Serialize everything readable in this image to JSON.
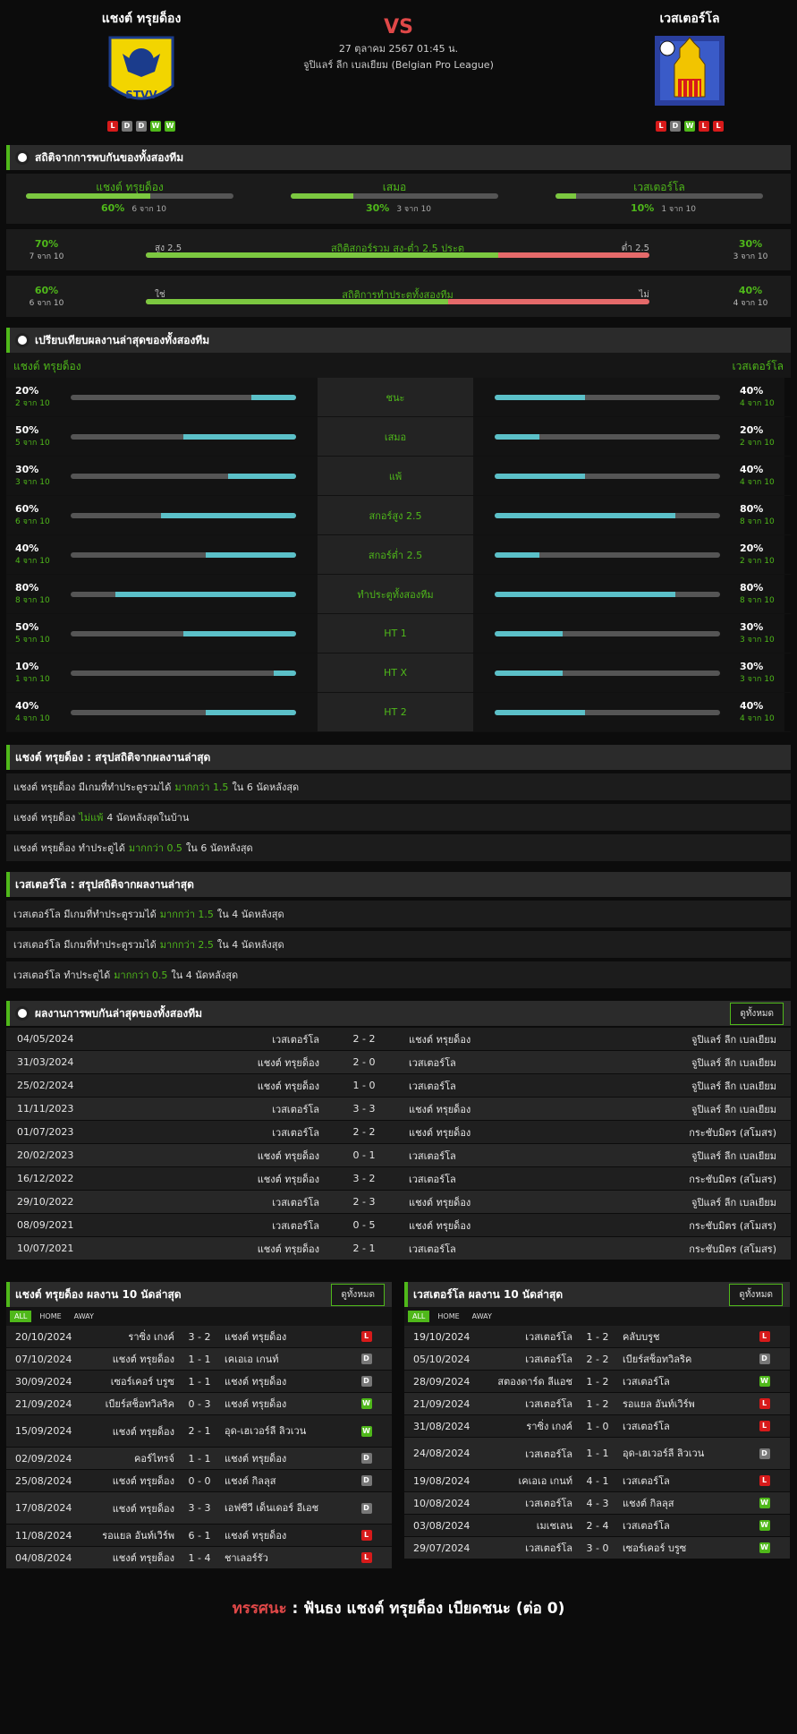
{
  "header": {
    "home_name": "แชงต์ ทรุยด็อง",
    "away_name": "เวสเตอร์โล",
    "vs": "VS",
    "datetime": "27 ตุลาคม 2567 01:45 น.",
    "league": "จูปิแลร์ ลีก เบลเยียม (Belgian Pro League)",
    "home_form": [
      "L",
      "D",
      "D",
      "W",
      "W"
    ],
    "away_form": [
      "L",
      "D",
      "W",
      "L",
      "L"
    ],
    "home_logo_text": "STVV"
  },
  "h2h": {
    "title": "สถิติจากการพบกันของทั้งสองทีม",
    "cols": [
      {
        "label": "แชงต์ ทรุยด็อง",
        "pct": "60%",
        "sub": "6 จาก 10",
        "fill": 0.6
      },
      {
        "label": "เสมอ",
        "pct": "30%",
        "sub": "3 จาก 10",
        "fill": 0.3
      },
      {
        "label": "เวสเตอร์โล",
        "pct": "10%",
        "sub": "1 จาก 10",
        "fill": 0.1
      }
    ],
    "goals": {
      "left_pct": "70%",
      "left_sub": "7 จาก 10",
      "title": "สถิติสกอร์รวม สูง-ต่ำ 2.5 ประตู",
      "ll": "สูง 2.5",
      "rl": "ต่ำ 2.5",
      "right_pct": "30%",
      "right_sub": "3 จาก 10",
      "fill": 0.7
    },
    "btts": {
      "left_pct": "60%",
      "left_sub": "6 จาก 10",
      "title": "สถิติการทำประตูทั้งสองทีม",
      "ll": "ใช่",
      "rl": "ไม่",
      "right_pct": "40%",
      "right_sub": "4 จาก 10",
      "fill": 0.6
    }
  },
  "compare": {
    "title": "เปรียบเทียบผลงานล่าสุดของทั้งสองทีม",
    "home": "แชงต์ ทรุยด็อง",
    "away": "เวสเตอร์โล",
    "rows": [
      {
        "label": "ชนะ",
        "hp": "20%",
        "hs": "2 จาก 10",
        "hv": 0.2,
        "ap": "40%",
        "as": "4 จาก 10",
        "av": 0.4
      },
      {
        "label": "เสมอ",
        "hp": "50%",
        "hs": "5 จาก 10",
        "hv": 0.5,
        "ap": "20%",
        "as": "2 จาก 10",
        "av": 0.2
      },
      {
        "label": "แพ้",
        "hp": "30%",
        "hs": "3 จาก 10",
        "hv": 0.3,
        "ap": "40%",
        "as": "4 จาก 10",
        "av": 0.4
      },
      {
        "label": "สกอร์สูง 2.5",
        "hp": "60%",
        "hs": "6 จาก 10",
        "hv": 0.6,
        "ap": "80%",
        "as": "8 จาก 10",
        "av": 0.8
      },
      {
        "label": "สกอร์ต่ำ 2.5",
        "hp": "40%",
        "hs": "4 จาก 10",
        "hv": 0.4,
        "ap": "20%",
        "as": "2 จาก 10",
        "av": 0.2
      },
      {
        "label": "ทำประตูทั้งสองทีม",
        "hp": "80%",
        "hs": "8 จาก 10",
        "hv": 0.8,
        "ap": "80%",
        "as": "8 จาก 10",
        "av": 0.8
      },
      {
        "label": "HT 1",
        "hp": "50%",
        "hs": "5 จาก 10",
        "hv": 0.5,
        "ap": "30%",
        "as": "3 จาก 10",
        "av": 0.3
      },
      {
        "label": "HT X",
        "hp": "10%",
        "hs": "1 จาก 10",
        "hv": 0.1,
        "ap": "30%",
        "as": "3 จาก 10",
        "av": 0.3
      },
      {
        "label": "HT 2",
        "hp": "40%",
        "hs": "4 จาก 10",
        "hv": 0.4,
        "ap": "40%",
        "as": "4 จาก 10",
        "av": 0.4
      }
    ]
  },
  "summary_home": {
    "title": "แชงต์ ทรุยด็อง : สรุปสถิติจากผลงานล่าสุด",
    "rows": [
      {
        "a": "แชงต์ ทรุยด็อง  มีเกมที่ทำประตูรวมได้",
        "h": "มากกว่า  1.5",
        "b": "ใน 6 นัดหลังสุด"
      },
      {
        "a": "แชงต์ ทรุยด็อง",
        "h": "ไม่แพ้",
        "b": "4  นัดหลังสุดในบ้าน"
      },
      {
        "a": "แชงต์ ทรุยด็อง  ทำประตูได้",
        "h": "มากกว่า  0.5",
        "b": "ใน 6 นัดหลังสุด"
      }
    ]
  },
  "summary_away": {
    "title": "เวสเตอร์โล : สรุปสถิติจากผลงานล่าสุด",
    "rows": [
      {
        "a": "เวสเตอร์โล  มีเกมที่ทำประตูรวมได้",
        "h": "มากกว่า  1.5",
        "b": "ใน 4 นัดหลังสุด"
      },
      {
        "a": "เวสเตอร์โล  มีเกมที่ทำประตูรวมได้",
        "h": "มากกว่า  2.5",
        "b": "ใน 4 นัดหลังสุด"
      },
      {
        "a": "เวสเตอร์โล  ทำประตูได้",
        "h": "มากกว่า  0.5",
        "b": "ใน 4 นัดหลังสุด"
      }
    ]
  },
  "matches": {
    "title": "ผลงานการพบกันล่าสุดของทั้งสองทีม",
    "btn": "ดูทั้งหมด",
    "rows": [
      [
        "04/05/2024",
        "เวสเตอร์โล",
        "2 - 2",
        "แชงต์ ทรุยด็อง",
        "จูปิแลร์ ลีก เบลเยียม"
      ],
      [
        "31/03/2024",
        "แชงต์ ทรุยด็อง",
        "2 - 0",
        "เวสเตอร์โล",
        "จูปิแลร์ ลีก เบลเยียม"
      ],
      [
        "25/02/2024",
        "แชงต์ ทรุยด็อง",
        "1 - 0",
        "เวสเตอร์โล",
        "จูปิแลร์ ลีก เบลเยียม"
      ],
      [
        "11/11/2023",
        "เวสเตอร์โล",
        "3 - 3",
        "แชงต์ ทรุยด็อง",
        "จูปิแลร์ ลีก เบลเยียม"
      ],
      [
        "01/07/2023",
        "เวสเตอร์โล",
        "2 - 2",
        "แชงต์ ทรุยด็อง",
        "กระชับมิตร (สโมสร)"
      ],
      [
        "20/02/2023",
        "แชงต์ ทรุยด็อง",
        "0 - 1",
        "เวสเตอร์โล",
        "จูปิแลร์ ลีก เบลเยียม"
      ],
      [
        "16/12/2022",
        "แชงต์ ทรุยด็อง",
        "3 - 2",
        "เวสเตอร์โล",
        "กระชับมิตร (สโมสร)"
      ],
      [
        "29/10/2022",
        "เวสเตอร์โล",
        "2 - 3",
        "แชงต์ ทรุยด็อง",
        "จูปิแลร์ ลีก เบลเยียม"
      ],
      [
        "08/09/2021",
        "เวสเตอร์โล",
        "0 - 5",
        "แชงต์ ทรุยด็อง",
        "กระชับมิตร (สโมสร)"
      ],
      [
        "10/07/2021",
        "แชงต์ ทรุยด็อง",
        "2 - 1",
        "เวสเตอร์โล",
        "กระชับมิตร (สโมสร)"
      ]
    ]
  },
  "last_home": {
    "title": "แชงต์ ทรุยด็อง ผลงาน 10 นัดล่าสุด",
    "btn": "ดูทั้งหมด",
    "tabs": [
      "ALL",
      "HOME",
      "AWAY"
    ],
    "rows": [
      [
        "20/10/2024",
        "ราซิ่ง เกงค์",
        "3 - 2",
        "แชงต์ ทรุยด็อง",
        "L"
      ],
      [
        "07/10/2024",
        "แชงต์ ทรุยด็อง",
        "1 - 1",
        "เคเอเอ เกนท์",
        "D"
      ],
      [
        "30/09/2024",
        "เซอร์เคอร์ บรูซ",
        "1 - 1",
        "แชงต์ ทรุยด็อง",
        "D"
      ],
      [
        "21/09/2024",
        "เบียร์สช็อทวิลริค",
        "0 - 3",
        "แชงต์ ทรุยด็อง",
        "W"
      ],
      [
        "15/09/2024",
        "แชงต์ ทรุยด็อง",
        "2 - 1",
        "อุด-เฮเวอร์ลี ลิวเวน",
        "W"
      ],
      [
        "02/09/2024",
        "คอร์ไทรจ์",
        "1 - 1",
        "แชงต์ ทรุยด็อง",
        "D"
      ],
      [
        "25/08/2024",
        "แชงต์ ทรุยด็อง",
        "0 - 0",
        "แชงต์ กิลลุส",
        "D"
      ],
      [
        "17/08/2024",
        "แชงต์ ทรุยด็อง",
        "3 - 3",
        "เอฟซีวี เด็นเดอร์ อีเอช",
        "D"
      ],
      [
        "11/08/2024",
        "รอแยล อันท์เวิร์พ",
        "6 - 1",
        "แชงต์ ทรุยด็อง",
        "L"
      ],
      [
        "04/08/2024",
        "แชงต์ ทรุยด็อง",
        "1 - 4",
        "ชาเลอร์รัว",
        "L"
      ]
    ]
  },
  "last_away": {
    "title": "เวสเตอร์โล ผลงาน 10 นัดล่าสุด",
    "btn": "ดูทั้งหมด",
    "tabs": [
      "ALL",
      "HOME",
      "AWAY"
    ],
    "rows": [
      [
        "19/10/2024",
        "เวสเตอร์โล",
        "1 - 2",
        "คลับบรูช",
        "L"
      ],
      [
        "05/10/2024",
        "เวสเตอร์โล",
        "2 - 2",
        "เบียร์สช็อทวิลริค",
        "D"
      ],
      [
        "28/09/2024",
        "สตองดาร์ด ลีแอช",
        "1 - 2",
        "เวสเตอร์โล",
        "W"
      ],
      [
        "21/09/2024",
        "เวสเตอร์โล",
        "1 - 2",
        "รอแยล อันท์เวิร์พ",
        "L"
      ],
      [
        "31/08/2024",
        "ราซิ่ง เกงค์",
        "1 - 0",
        "เวสเตอร์โล",
        "L"
      ],
      [
        "24/08/2024",
        "เวสเตอร์โล",
        "1 - 1",
        "อุด-เฮเวอร์ลี ลิวเวน",
        "D"
      ],
      [
        "19/08/2024",
        "เคเอเอ เกนท์",
        "4 - 1",
        "เวสเตอร์โล",
        "L"
      ],
      [
        "10/08/2024",
        "เวสเตอร์โล",
        "4 - 3",
        "แชงต์ กิลลุส",
        "W"
      ],
      [
        "03/08/2024",
        "เมเชเลน",
        "2 - 4",
        "เวสเตอร์โล",
        "W"
      ],
      [
        "29/07/2024",
        "เวสเตอร์โล",
        "3 - 0",
        "เซอร์เคอร์ บรูซ",
        "W"
      ]
    ]
  },
  "verdict": {
    "key": "ทรรศนะ",
    "sep": ":",
    "text": "ฟันธง แชงต์ ทรุยด็อง เบียดชนะ (ต่อ 0)"
  }
}
